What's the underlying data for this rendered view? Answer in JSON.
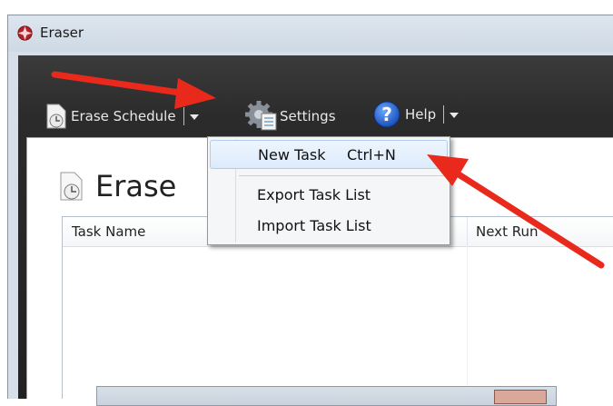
{
  "window": {
    "title": "Eraser"
  },
  "toolbar": {
    "erase_schedule": "Erase Schedule",
    "settings": "Settings",
    "help": "Help"
  },
  "panel": {
    "title": "Erase"
  },
  "grid": {
    "columns": [
      "Task Name",
      "Next Run"
    ]
  },
  "menu": {
    "items": [
      {
        "label": "New Task",
        "shortcut": "Ctrl+N"
      },
      {
        "label": "Export Task List"
      },
      {
        "label": "Import Task List"
      }
    ]
  },
  "colors": {
    "arrow": "#e8291c",
    "toolbar_bg": "#2b2b2b",
    "menu_highlight": "#dcebfb"
  },
  "icons": [
    "eraser-app-icon",
    "clock-document-icon",
    "gear-icon",
    "help-icon",
    "chevron-down-icon",
    "red-arrow-annotation"
  ]
}
